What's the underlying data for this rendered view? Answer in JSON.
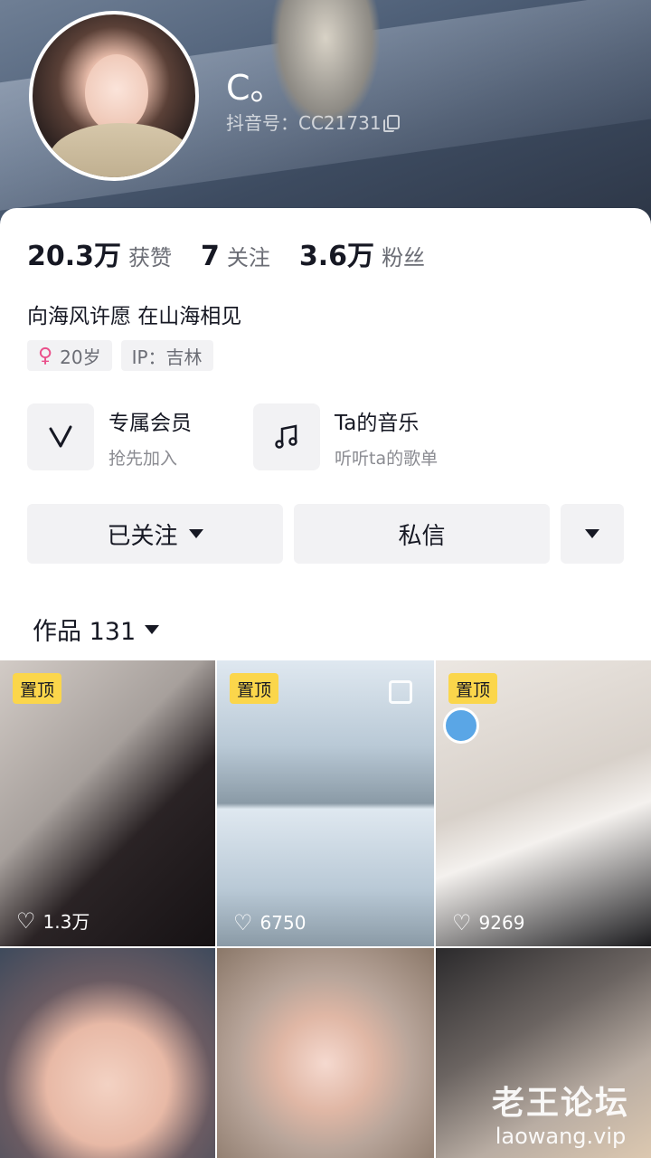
{
  "profile": {
    "nickname": "C。",
    "douyin_id": "抖音号：CC21731"
  },
  "stats": [
    {
      "value": "20.3万",
      "label": "获赞"
    },
    {
      "value": "7",
      "label": "关注"
    },
    {
      "value": "3.6万",
      "label": "粉丝"
    }
  ],
  "bio": "向海风许愿 在山海相见",
  "tags": {
    "age": "20岁",
    "ip": "IP：吉林"
  },
  "features": [
    {
      "title": "专属会员",
      "subtitle": "抢先加入",
      "icon": "v-icon"
    },
    {
      "title": "Ta的音乐",
      "subtitle": "听听ta的歌单",
      "icon": "music-note-icon"
    }
  ],
  "actions": {
    "follow": "已关注",
    "message": "私信"
  },
  "works_tab": "作品 131",
  "videos": [
    {
      "pinned": "置顶",
      "likes": "1.3万"
    },
    {
      "pinned": "置顶",
      "likes": "6750"
    },
    {
      "pinned": "置顶",
      "likes": "9269"
    },
    {
      "pinned": "",
      "likes": ""
    },
    {
      "pinned": "",
      "likes": ""
    },
    {
      "pinned": "",
      "likes": ""
    }
  ],
  "watermark": {
    "line1": "老王论坛",
    "line2": "laowang.vip"
  },
  "colors": {
    "pin_bg": "#fbd64b",
    "female_icon": "#ea4f8a",
    "button_bg": "#f2f2f4"
  }
}
